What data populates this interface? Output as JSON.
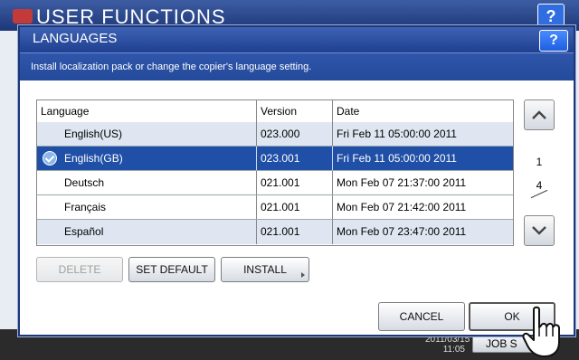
{
  "background": {
    "title": "USER FUNCTIONS",
    "help": "?",
    "clock_line1": "2011/03/15",
    "clock_line2": "11:05",
    "job_status": "JOB S"
  },
  "dialog": {
    "title": "LANGUAGES",
    "help": "?",
    "info": "Install localization pack or change the copier's language setting."
  },
  "table": {
    "headers": [
      "Language",
      "Version",
      "Date"
    ],
    "rows": [
      {
        "language": "English(US)",
        "version": "023.000",
        "date": "Fri Feb 11 05:00:00 2011"
      },
      {
        "language": "English(GB)",
        "version": "023.001",
        "date": "Fri Feb 11 05:00:00 2011"
      },
      {
        "language": "Deutsch",
        "version": "021.001",
        "date": "Mon Feb 07 21:37:00 2011"
      },
      {
        "language": "Français",
        "version": "021.001",
        "date": "Mon Feb 07 21:42:00 2011"
      },
      {
        "language": "Español",
        "version": "021.001",
        "date": "Mon Feb 07 23:47:00 2011"
      }
    ],
    "selected_index": 1
  },
  "pager": {
    "current": "1",
    "total": "4"
  },
  "buttons": {
    "delete": "DELETE",
    "set_default": "SET DEFAULT",
    "install": "INSTALL",
    "cancel": "CANCEL",
    "ok": "OK"
  },
  "colors": {
    "selected_row": "#1f4fa6",
    "title_bar": "#1f3f8f",
    "alt_row": "#dfe6f1"
  }
}
